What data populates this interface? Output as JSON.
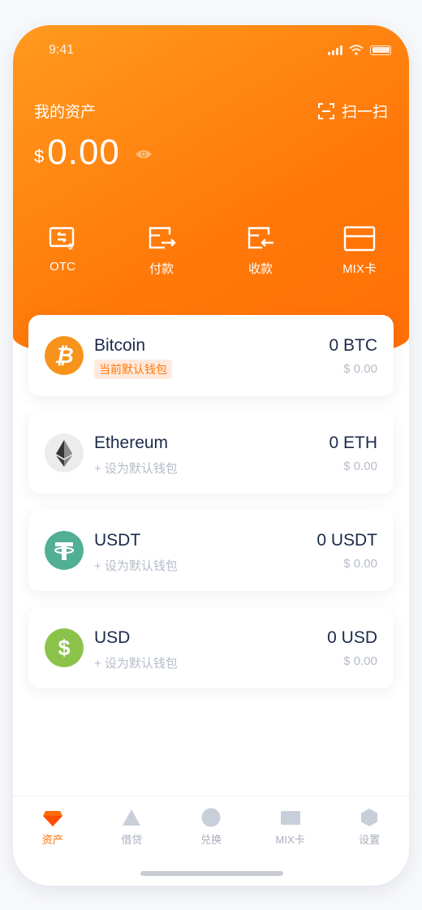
{
  "status": {
    "time": "9:41"
  },
  "header": {
    "title": "我的资产",
    "scan_label": "扫一扫"
  },
  "balance": {
    "currency": "$",
    "amount": "0.00"
  },
  "actions": [
    {
      "icon": "otc-icon",
      "label": "OTC"
    },
    {
      "icon": "pay-icon",
      "label": "付款"
    },
    {
      "icon": "receive-icon",
      "label": "收款"
    },
    {
      "icon": "card-icon",
      "label": "MIX卡"
    }
  ],
  "wallets": [
    {
      "name": "Bitcoin",
      "amount": "0 BTC",
      "usd": "$ 0.00",
      "tag": "当前默认钱包",
      "is_default": true,
      "color": "#f7931a"
    },
    {
      "name": "Ethereum",
      "amount": "0 ETH",
      "usd": "$ 0.00",
      "set_default": "+ 设为默认钱包",
      "is_default": false,
      "color": "#ececec"
    },
    {
      "name": "USDT",
      "amount": "0 USDT",
      "usd": "$ 0.00",
      "set_default": "+ 设为默认钱包",
      "is_default": false,
      "color": "#50af95"
    },
    {
      "name": "USD",
      "amount": "0 USD",
      "usd": "$ 0.00",
      "set_default": "+ 设为默认钱包",
      "is_default": false,
      "color": "#8bc34a"
    }
  ],
  "tabs": [
    {
      "label": "资产",
      "icon": "diamond-icon",
      "active": true
    },
    {
      "label": "借贷",
      "icon": "triangle-icon",
      "active": false
    },
    {
      "label": "兑换",
      "icon": "circle-icon",
      "active": false
    },
    {
      "label": "MIX卡",
      "icon": "card-icon",
      "active": false
    },
    {
      "label": "设置",
      "icon": "hexagon-icon",
      "active": false
    }
  ],
  "colors": {
    "accent": "#ff7a0a",
    "text": "#1c2a4a",
    "muted": "#b6bcc9"
  }
}
